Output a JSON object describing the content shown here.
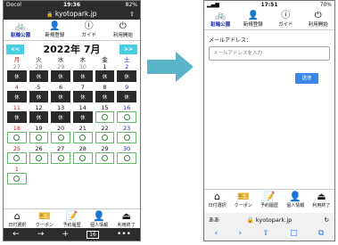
{
  "left_screen": {
    "status": {
      "carrier": "Docol",
      "time": "19:36",
      "battery": "82%"
    },
    "url": "kyotopark.jp",
    "nav": [
      {
        "label": "駐輪公園",
        "icon": "bike-icon",
        "glyph": "🚲"
      },
      {
        "label": "新規登録",
        "icon": "register-icon",
        "glyph": "👤"
      },
      {
        "label": "ガイド",
        "icon": "info-icon",
        "glyph": "ⓘ"
      },
      {
        "label": "利用開始",
        "icon": "login-icon",
        "glyph": "⏻"
      }
    ],
    "calendar": {
      "prev_label": "<<",
      "next_label": ">>",
      "title": "2022年 7月",
      "weekdays": [
        "月",
        "火",
        "水",
        "木",
        "金",
        "土"
      ],
      "weeks": [
        {
          "days": [
            "27",
            "28",
            "29",
            "30",
            "1",
            "2"
          ],
          "status": [
            "x",
            "x",
            "x",
            "x",
            "x",
            "x"
          ]
        },
        {
          "days": [
            "4",
            "5",
            "6",
            "7",
            "8",
            "9"
          ],
          "status": [
            "x",
            "x",
            "x",
            "x",
            "x",
            "x"
          ]
        },
        {
          "days": [
            "11",
            "12",
            "13",
            "14",
            "15",
            "16"
          ],
          "status": [
            "x",
            "x",
            "x",
            "x",
            "o",
            "o"
          ]
        },
        {
          "days": [
            "18",
            "19",
            "20",
            "21",
            "22",
            "23"
          ],
          "status": [
            "o",
            "o",
            "o",
            "o",
            "o",
            "o"
          ]
        },
        {
          "days": [
            "25",
            "26",
            "27",
            "28",
            "29",
            "30"
          ],
          "status": [
            "o",
            "o",
            "o",
            "o",
            "o",
            "o"
          ]
        },
        {
          "days": [
            "1",
            "",
            "",
            "",
            "",
            ""
          ],
          "status": [
            "o",
            "e",
            "e",
            "e",
            "e",
            "e"
          ]
        }
      ],
      "closed_label": "休"
    },
    "bottom_nav": [
      {
        "label": "日付選択",
        "icon": "home-icon",
        "glyph": "⌂"
      },
      {
        "label": "クーポン",
        "icon": "coupon-icon",
        "glyph": "🎫"
      },
      {
        "label": "予約履歴",
        "icon": "history-icon",
        "glyph": "📝"
      },
      {
        "label": "個人情報",
        "icon": "person-icon",
        "glyph": "👤"
      },
      {
        "label": "利用終了",
        "icon": "logout-icon",
        "glyph": "⏏"
      }
    ],
    "browser_controls": {
      "back": "←",
      "forward": "→",
      "new_tab": "+",
      "tabs": "16",
      "more": "•••"
    }
  },
  "right_screen": {
    "status": {
      "time": "17:51",
      "battery": "70%"
    },
    "nav": [
      {
        "label": "駐輪公園",
        "icon": "bike-icon",
        "glyph": "🚲"
      },
      {
        "label": "新規登録",
        "icon": "register-icon",
        "glyph": "👤"
      },
      {
        "label": "ガイド",
        "icon": "info-icon",
        "glyph": "ⓘ"
      },
      {
        "label": "利用開始",
        "icon": "login-icon",
        "glyph": "⏻"
      }
    ],
    "form": {
      "email_label": "メールアドレス：",
      "email_placeholder": "メールアドレスを入力",
      "submit_label": "送信"
    },
    "bottom_nav": [
      {
        "label": "日付選択",
        "icon": "home-icon",
        "glyph": "⌂"
      },
      {
        "label": "クーポン",
        "icon": "coupon-icon",
        "glyph": "🎫"
      },
      {
        "label": "予約履歴",
        "icon": "history-icon",
        "glyph": "📝"
      },
      {
        "label": "個人情報",
        "icon": "person-icon",
        "glyph": "👤"
      },
      {
        "label": "利用終了",
        "icon": "logout-icon",
        "glyph": "⏏"
      }
    ],
    "browser": {
      "aa": "ああ",
      "url": "kyotopark.jp",
      "reload": "↻"
    },
    "toolbar": {
      "back": "‹",
      "forward": "›",
      "share": "⇪",
      "bookmarks": "□",
      "tabs": "⧉"
    }
  },
  "colors": {
    "accent": "#4acfe0",
    "arrow": "#5ab4c8",
    "submit": "#3a86e8",
    "available_border": "#66b86a"
  }
}
